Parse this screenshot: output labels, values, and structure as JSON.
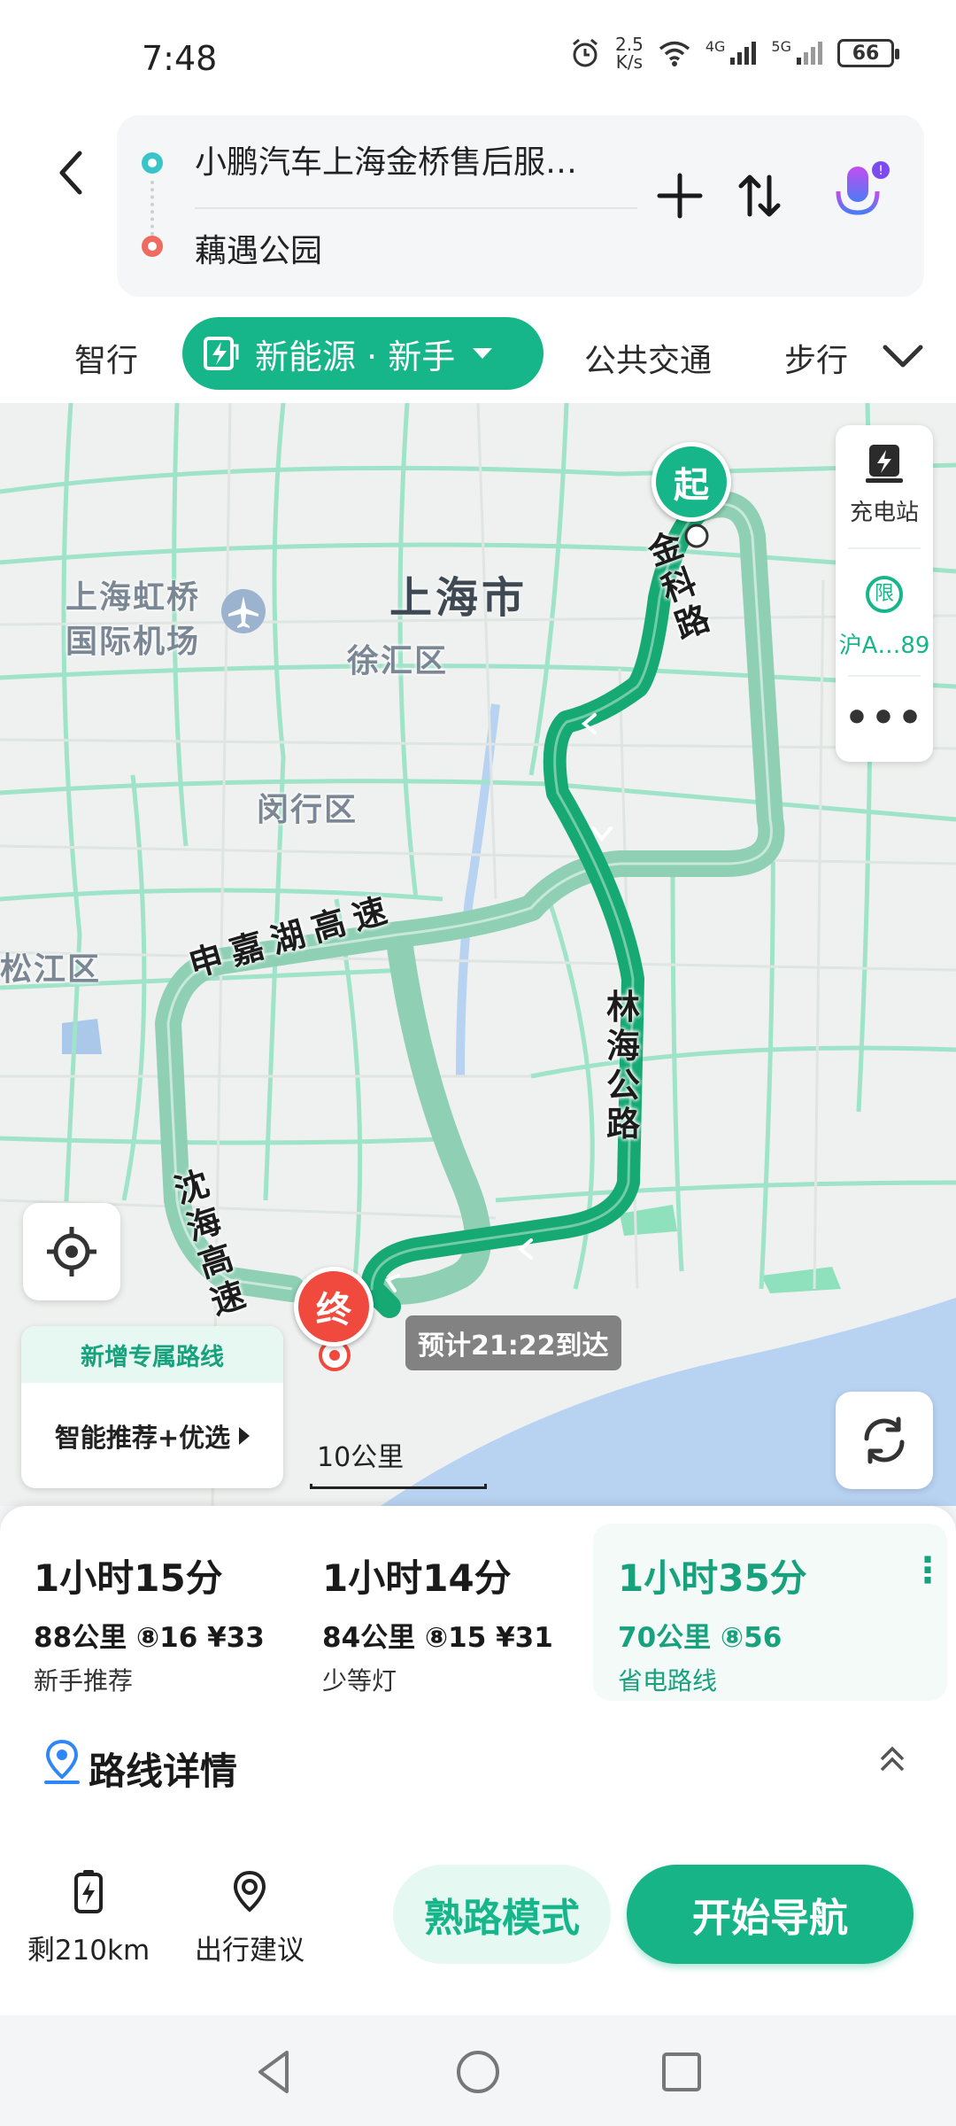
{
  "status_bar": {
    "time": "7:48",
    "net_speed_value": "2.5",
    "net_speed_unit": "K/s",
    "battery": "66",
    "signal_1": "4G",
    "signal_2": "5G"
  },
  "search": {
    "origin": "小鹏汽车上海金桥售后服…",
    "destination": "藕遇公园"
  },
  "tabs": {
    "smart": "智行",
    "new_energy": "新能源 · 新手",
    "transit": "公共交通",
    "walk": "步行"
  },
  "map": {
    "city": "上海市",
    "airport_line1": "上海虹桥",
    "airport_line2": "国际机场",
    "district_xuhui": "徐汇区",
    "district_minhang": "闵行区",
    "district_songjiang": "松江区",
    "road_jinke": [
      "金",
      "科",
      "路"
    ],
    "road_linhai": [
      "林",
      "海",
      "公",
      "路"
    ],
    "road_shenjiahu": "申嘉湖高速",
    "road_shenhai": [
      "沈",
      "海",
      "高",
      "速"
    ],
    "start_label": "起",
    "end_label": "终",
    "eta": "预计21:22到达",
    "scale": "10公里",
    "side_tools": {
      "charging": "充电站",
      "plate": "沪A…89",
      "limit_icon_text": "限",
      "more": "•••"
    },
    "exclusive": {
      "title": "新增专属路线",
      "body": "智能推荐+优选"
    }
  },
  "routes": [
    {
      "time": "1小时15分",
      "stats": "88公里  ⑧16  ¥33",
      "tag": "新手推荐"
    },
    {
      "time": "1小时14分",
      "stats": "84公里  ⑧15  ¥31",
      "tag": "少等灯"
    },
    {
      "time": "1小时35分",
      "stats": "70公里  ⑧56",
      "tag": "省电路线"
    }
  ],
  "route_menu": "⋮",
  "details_title": "路线详情",
  "actions": {
    "range": "剩210km",
    "advice": "出行建议",
    "familiar": "熟路模式",
    "start": "开始导航"
  },
  "colors": {
    "accent": "#17b58a",
    "route_primary": "#16a974",
    "route_alt": "#8fd0b5",
    "end_pin": "#f04a3e"
  }
}
